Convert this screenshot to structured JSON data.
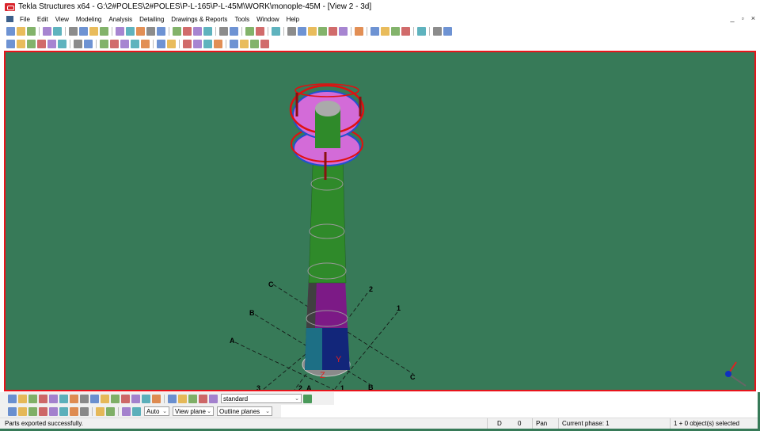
{
  "window": {
    "title": "Tekla Structures x64 - G:\\2#POLES\\2#POLES\\P-L-165\\P-L-45M\\WORK\\monople-45M - [View 2 - 3d]",
    "controls": [
      "_",
      "▫",
      "×"
    ]
  },
  "menu": [
    "File",
    "Edit",
    "View",
    "Modeling",
    "Analysis",
    "Detailing",
    "Drawings & Reports",
    "Tools",
    "Window",
    "Help"
  ],
  "toolbar1_icons": [
    "new",
    "open",
    "save",
    "|",
    "undo",
    "redo",
    "|",
    "copy",
    "open-model",
    "export",
    "print",
    "|",
    "view1",
    "view2",
    "view3",
    "cut",
    "select",
    "|",
    "part1",
    "part2",
    "part3",
    "part4",
    "|",
    "snap1",
    "snap2",
    "|",
    "grid1",
    "grid2",
    "|",
    "help",
    "|",
    "grid-line",
    "axis",
    "rotate",
    "measure",
    "arc",
    "weld",
    "|",
    "wand",
    "|",
    "component1",
    "component2",
    "component3",
    "component4",
    "|",
    "tekla",
    "|",
    "arrows",
    "palette"
  ],
  "toolbar2_icons": [
    "line",
    "point1",
    "point2",
    "point3",
    "point4",
    "point5",
    "|",
    "pt",
    "circle",
    "|",
    "column",
    "beam",
    "polybeam",
    "curved-beam",
    "plate",
    "|",
    "bolt",
    "weld2",
    "|",
    "binoculars",
    "tee",
    "split",
    "panel",
    "|",
    "marker",
    "ruler",
    "cube",
    "copy-obj"
  ],
  "selection_toolbar_icons": [
    "select-all",
    "select-part",
    "select-surface",
    "select-component",
    "select-grid",
    "select-points",
    "select-welds",
    "select-bolts",
    "select-cuts",
    "select-views",
    "select-assembly",
    "select-object",
    "select-reinforce",
    "select-drawing",
    "select-filter",
    "|",
    "select-assembly-top",
    "select-up",
    "select-down",
    "select-multi",
    "select-next"
  ],
  "snap_toolbar_icons": [
    "snap-ref",
    "snap-geom",
    "snap-center",
    "snap-mid",
    "snap-intersect",
    "snap-perp",
    "snap-ext",
    "snap-any",
    "|",
    "snap-line",
    "snap-free",
    "|",
    "snap-plane",
    "snap-3d"
  ],
  "filter_select": {
    "value": "standard"
  },
  "snap_depth": {
    "value": "Auto"
  },
  "plane_select": {
    "value": "View plane"
  },
  "outline_select": {
    "value": "Outline planes"
  },
  "grid_labels": {
    "a": "A",
    "b": "B",
    "c": "C",
    "n1": "1",
    "n2": "2",
    "n3": "3"
  },
  "axis_labels": {
    "y": "Y",
    "z": "Z"
  },
  "status": {
    "message": "Parts exported successfully.",
    "d": "D",
    "d_value": "0",
    "mode": "Pan",
    "phase": "Current phase: 1",
    "selected": "1 + 0 object(s) selected"
  },
  "colors": {
    "viewport_bg": "#377a58",
    "active_border": "#e8141b"
  }
}
